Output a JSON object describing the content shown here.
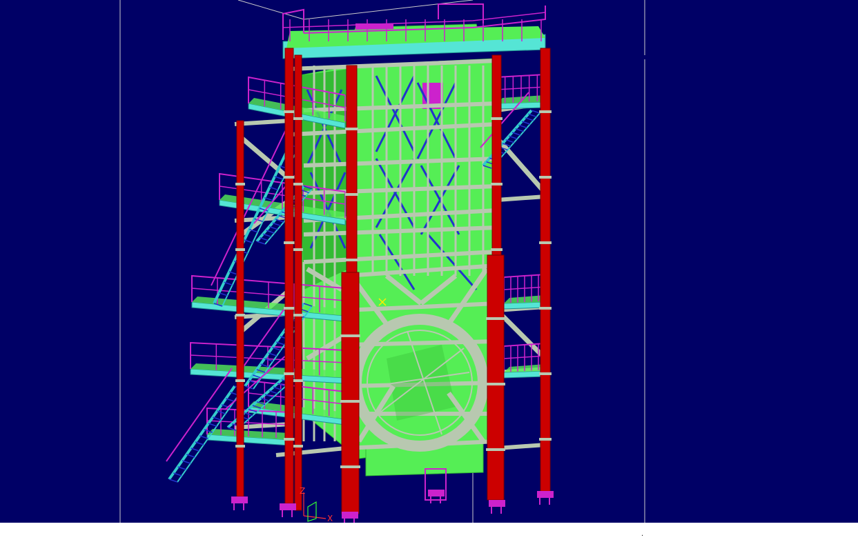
{
  "viewport": {
    "background": "#000066",
    "frame_line_color": "#cccccc"
  },
  "palette": {
    "column": "#cc0000",
    "column_edge": "#800000",
    "beam": "#b8c8b0",
    "beam_edge": "#5f6f5f",
    "panel": "#55ee55",
    "panel_dark": "#33bb33",
    "railing": "#cc22cc",
    "deck": "#55e5d5",
    "brace": "#2233cc",
    "stair": "#33cccc"
  },
  "axis_triad": {
    "z_label": "Z",
    "x_label": "X",
    "z_color": "#ff3333",
    "x_color": "#ff3333",
    "y_color": "#33ff33"
  },
  "cursor_marker": {
    "icon": "x-cursor-icon",
    "color": "#ffee00"
  },
  "status_bar": {
    "text": "."
  }
}
